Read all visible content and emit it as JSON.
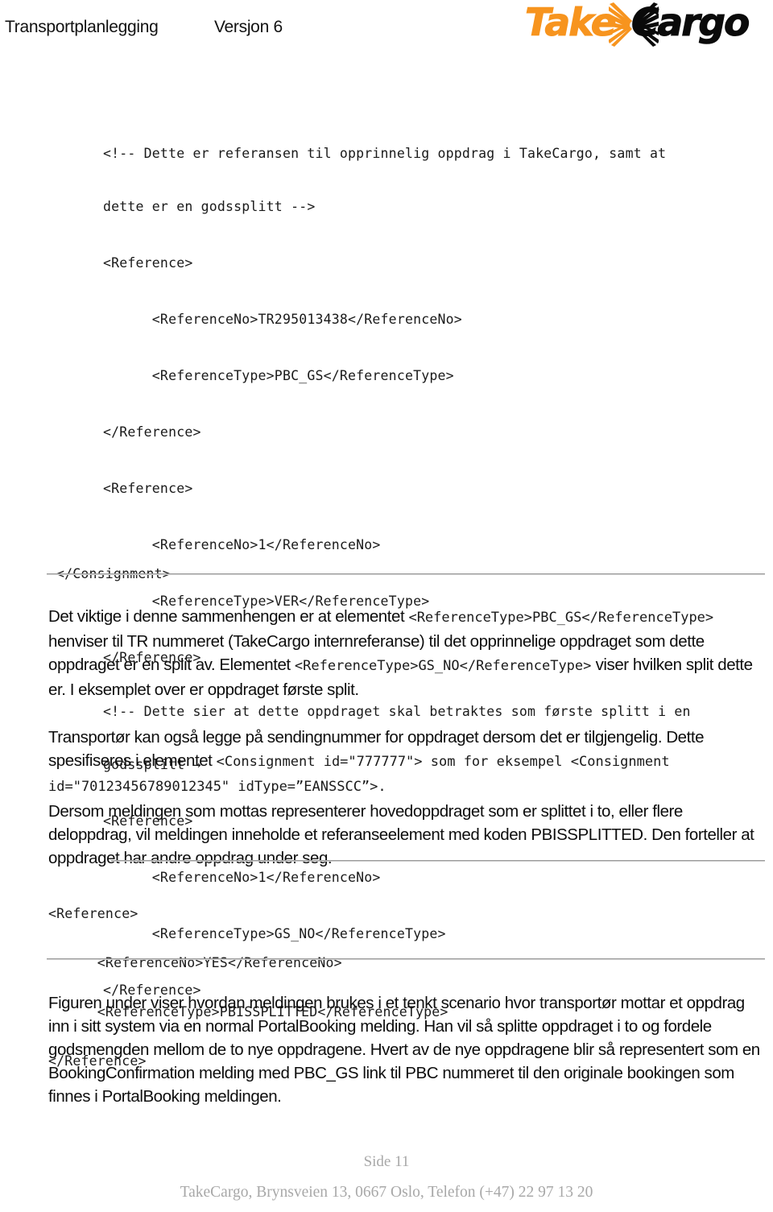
{
  "header": {
    "doc_title": "Transportplanlegging",
    "version": "Versjon 6",
    "logo": {
      "word_one": "Take",
      "word_two": "Cargo",
      "orange": "#F7941E",
      "black": "#0A0A0A",
      "burst_icon": "x-starburst-icon"
    }
  },
  "code_block_1": {
    "lines": [
      "<!-- Dette er referansen til opprinnelig oppdrag i TakeCargo, samt at",
      "dette er en godssplitt -->",
      "<Reference>",
      "      <ReferenceNo>TR295013438</ReferenceNo>",
      "      <ReferenceType>PBC_GS</ReferenceType>",
      "</Reference>",
      "<Reference>",
      "      <ReferenceNo>1</ReferenceNo>",
      "      <ReferenceType>VER</ReferenceType>",
      "</Reference>",
      "<!-- Dette sier at dette oppdraget skal betraktes som første splitt i en",
      "godssplitt →",
      "<Reference>",
      "      <ReferenceNo>1</ReferenceNo>",
      "      <ReferenceType>GS_NO</ReferenceType>",
      "</Reference>"
    ],
    "closing_line": "</Consignment>"
  },
  "code_block_2": {
    "lines": [
      "<Reference>",
      "      <ReferenceNo>YES</ReferenceNo>",
      "      <ReferenceType>PBISSPLITTED</ReferenceType>",
      "</Reference>"
    ]
  },
  "paragraphs": {
    "p1": {
      "seg1": "Det viktige i denne sammenhengen er at elementet ",
      "mono1": "<ReferenceType>PBC_GS</ReferenceType>",
      "seg2": " henviser til TR nummeret (TakeCargo internreferanse) til det opprinnelige oppdraget som dette oppdraget er en split av.  Elementet ",
      "mono2": "<ReferenceType>GS_NO</ReferenceType>",
      "seg3": " viser hvilken split dette er.  I eksemplet over er oppdraget første split."
    },
    "p2": {
      "seg1": "Transportør kan også legge på sendingnummer for oppdraget dersom det er tilgjengelig.  Dette spesifiseres i elementet ",
      "mono1": "<Consignment id=\"777777\"> som for eksempel <Consignment id=\"70123456789012345\" idType=”EANSSCC”>."
    },
    "p3": {
      "text": "Dersom meldingen som mottas representerer hovedoppdraget som er splittet i to, eller flere deloppdrag, vil meldingen inneholde et referanseelement med koden PBISSPLITTED.  Den forteller at oppdraget har andre oppdrag under seg."
    },
    "p4": {
      "text": "Figuren under viser hvordan meldingen brukes i et tenkt scenario hvor transportør mottar et oppdrag inn i sitt system via en normal PortalBooking melding.  Han vil så splitte oppdraget i to og fordele godsmengden mellom de to nye oppdragene.  Hvert av de nye oppdragene blir så representert som en BookingConfirmation melding med PBC_GS link til PBC nummeret til den originale bookingen som finnes i PortalBooking meldingen."
    }
  },
  "footer": {
    "page_label": "Side 11",
    "address": "TakeCargo, Brynsveien 13, 0667 Oslo, Telefon (+47)  22 97 13 20"
  }
}
